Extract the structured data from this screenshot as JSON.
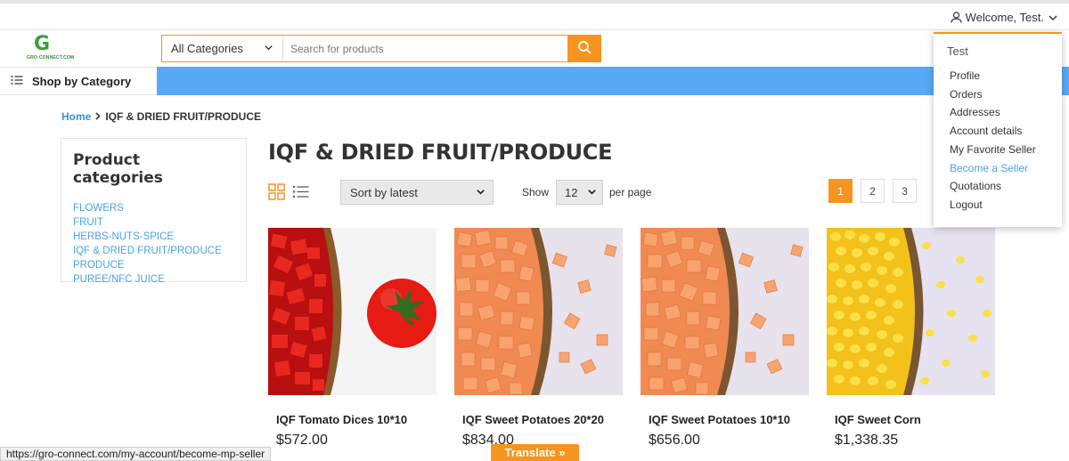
{
  "account": {
    "welcome": "Welcome, Test."
  },
  "logo": {
    "mark": "G",
    "text": "GRO-CONNECT.COM"
  },
  "search": {
    "category": "All Categories",
    "placeholder": "Search for products"
  },
  "nav": {
    "shop_by_category": "Shop by Category"
  },
  "breadcrumb": {
    "home": "Home",
    "current": "IQF & DRIED FRUIT/PRODUCE"
  },
  "sidebar": {
    "title": "Product categories",
    "items": [
      "FLOWERS",
      "FRUIT",
      "HERBS-NUTS-SPICE",
      "IQF & DRIED FRUIT/PRODUCE",
      "PRODUCE",
      "PUREE/NFC JUICE"
    ]
  },
  "page": {
    "title": "IQF & DRIED FRUIT/PRODUCE"
  },
  "toolbar": {
    "sort": "Sort by latest",
    "show_label": "Show",
    "per_page_value": "12",
    "per_page_label": "per page",
    "pages": [
      "1",
      "2",
      "3"
    ],
    "active_page": "1"
  },
  "products": [
    {
      "name": "IQF Tomato Dices 10*10",
      "price": "$572.00",
      "image": "tomato-dices"
    },
    {
      "name": "IQF Sweet Potatoes 20*20",
      "price": "$834.00",
      "image": "sweet-potato-dices"
    },
    {
      "name": "IQF Sweet Potatoes 10*10",
      "price": "$656.00",
      "image": "sweet-potato-dices"
    },
    {
      "name": "IQF Sweet Corn",
      "price": "$1,338.35",
      "image": "sweet-corn"
    }
  ],
  "account_menu": {
    "header": "Test",
    "items": [
      "Profile",
      "Orders",
      "Addresses",
      "Account details",
      "My Favorite Seller",
      "Become a Seller",
      "Quotations",
      "Logout"
    ],
    "hovered": "Become a Seller"
  },
  "status_url": "https://gro-connect.com/my-account/become-mp-seller",
  "translate": "Translate »",
  "colors": {
    "accent": "#f7941d",
    "nav": "#57a9f6",
    "link": "#4aa3e8"
  }
}
